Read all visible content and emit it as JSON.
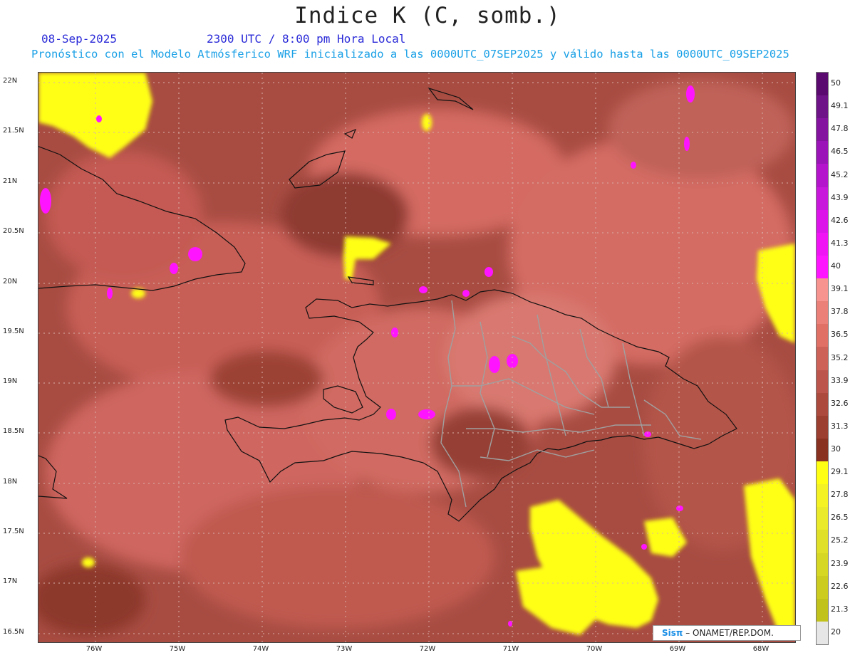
{
  "title": "Indice K (C, somb.)",
  "date": "08-Sep-2025",
  "time": "2300 UTC / 8:00 pm Hora Local",
  "model": "Pronóstico con el Modelo Atmósferico WRF inicializado a las 0000UTC_07SEP2025 y válido hasta las  0000UTC_09SEP2025",
  "lat_labels": [
    "22N",
    "21.5N",
    "21N",
    "20.5N",
    "20N",
    "19.5N",
    "19N",
    "18.5N",
    "18N",
    "17.5N",
    "17N",
    "16.5N"
  ],
  "lon_labels": [
    "76W",
    "75W",
    "74W",
    "73W",
    "72W",
    "71W",
    "70W",
    "69W",
    "68W"
  ],
  "colorbar": {
    "labels": [
      "50",
      "49.1",
      "47.8",
      "46.5",
      "45.2",
      "43.9",
      "42.6",
      "41.3",
      "40",
      "39.1",
      "37.8",
      "36.5",
      "35.2",
      "33.9",
      "32.6",
      "31.3",
      "30",
      "29.1",
      "27.8",
      "26.5",
      "25.2",
      "23.9",
      "22.6",
      "21.3",
      "20"
    ],
    "colors": [
      "#5a0a6e",
      "#6e1488",
      "#8414a0",
      "#9a14b8",
      "#b414cc",
      "#c818dc",
      "#dc14ea",
      "#f014f4",
      "#ff14ff",
      "#f79490",
      "#ea8078",
      "#e07066",
      "#cc6258",
      "#bc564c",
      "#ac4a3e",
      "#9c3e30",
      "#8a3222",
      "#ffff14",
      "#f4f224",
      "#eaea2a",
      "#e0e028",
      "#d6d624",
      "#cccc20",
      "#c2c21c",
      "#e6e6e6"
    ]
  },
  "credit": {
    "brand": "Sisπ",
    "text": "– ONAMET/REP.DOM."
  }
}
